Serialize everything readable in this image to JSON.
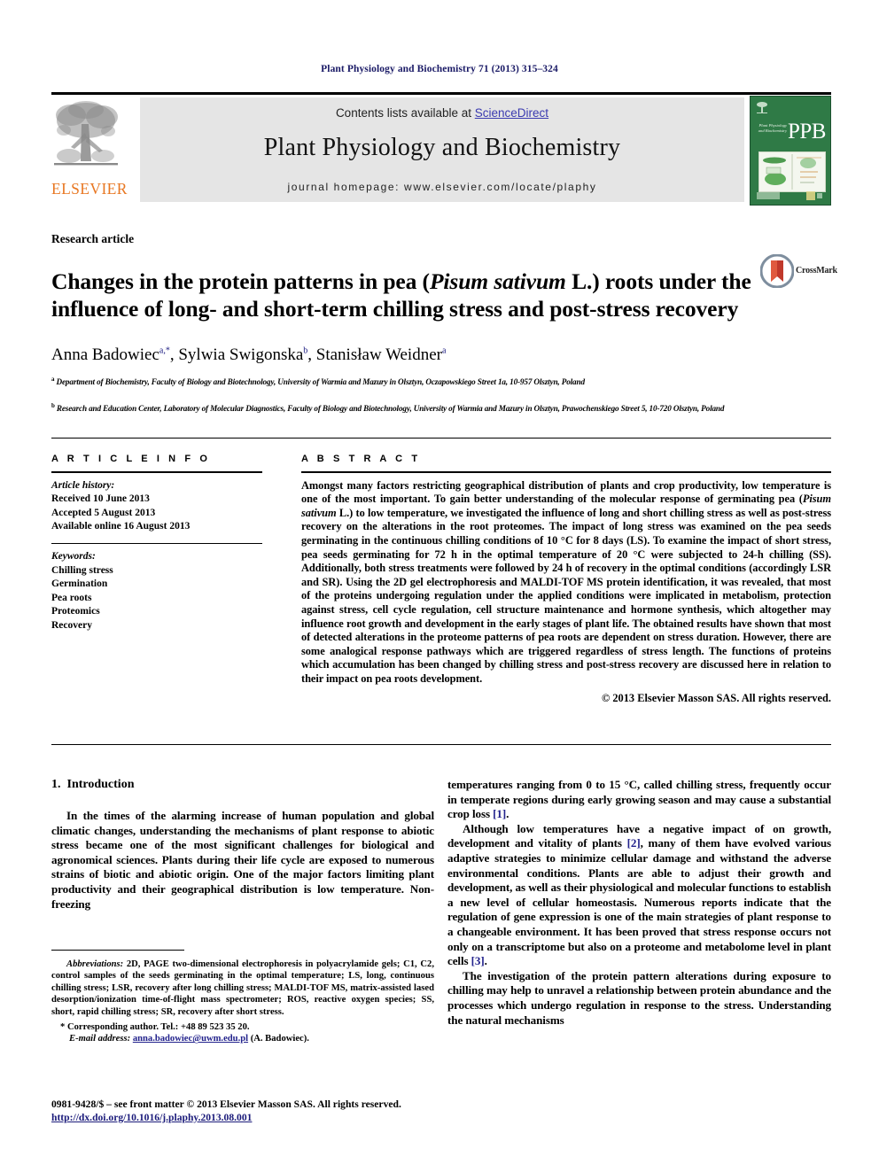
{
  "running_head": "Plant Physiology and Biochemistry 71 (2013) 315–324",
  "masthead": {
    "contents_prefix": "Contents lists available at ",
    "sciencedirect": "ScienceDirect",
    "journal_title": "Plant Physiology and Biochemistry",
    "homepage": "journal homepage: www.elsevier.com/locate/plaphy",
    "publisher_wordmark": "ELSEVIER",
    "cover_abbrev": "PPB",
    "cover_lines": "Plant Physiology and Biochemistry",
    "accent_orange": "#E87722",
    "cover_green": "#2f7a46",
    "link_blue": "#3a3ab0"
  },
  "article": {
    "type": "Research article",
    "title_part1": "Changes in the protein patterns in pea (",
    "title_italic": "Pisum sativum",
    "title_part2": " L.) roots under the influence of long- and short-term chilling stress and post-stress recovery",
    "crossmark_label": "CrossMark",
    "authors_html": "Anna Badowiec a,*, Sylwia Swigonska b, Stanisław Weidner a",
    "affiliation_a": "Department of Biochemistry, Faculty of Biology and Biotechnology, University of Warmia and Mazury in Olsztyn, Oczapowskiego Street 1a, 10-957 Olsztyn, Poland",
    "affiliation_b": "Research and Education Center, Laboratory of Molecular Diagnostics, Faculty of Biology and Biotechnology, University of Warmia and Mazury in Olsztyn, Prawochenskiego Street 5, 10-720 Olsztyn, Poland"
  },
  "info": {
    "heading": "A R T I C L E   I N F O",
    "history_label": "Article history:",
    "history": [
      "Received 10 June 2013",
      "Accepted 5 August 2013",
      "Available online 16 August 2013"
    ],
    "keywords_label": "Keywords:",
    "keywords": [
      "Chilling stress",
      "Germination",
      "Pea roots",
      "Proteomics",
      "Recovery"
    ]
  },
  "abstract": {
    "heading": "A B S T R A C T",
    "text_1": "Amongst many factors restricting geographical distribution of plants and crop productivity, low temperature is one of the most important. To gain better understanding of the molecular response of germinating pea (",
    "species": "Pisum sativum",
    "text_2": " L.) to low temperature, we investigated the influence of long and short chilling stress as well as post-stress recovery on the alterations in the root proteomes. The impact of long stress was examined on the pea seeds germinating in the continuous chilling conditions of 10 °C for 8 days (LS). To examine the impact of short stress, pea seeds germinating for 72 h in the optimal temperature of 20 °C were subjected to 24-h chilling (SS). Additionally, both stress treatments were followed by 24 h of recovery in the optimal conditions (accordingly LSR and SR). Using the 2D gel electrophoresis and MALDI-TOF MS protein identification, it was revealed, that most of the proteins undergoing regulation under the applied conditions were implicated in metabolism, protection against stress, cell cycle regulation, cell structure maintenance and hormone synthesis, which altogether may influence root growth and development in the early stages of plant life. The obtained results have shown that most of detected alterations in the proteome patterns of pea roots are dependent on stress duration. However, there are some analogical response pathways which are triggered regardless of stress length. The functions of proteins which accumulation has been changed by chilling stress and post-stress recovery are discussed here in relation to their impact on pea roots development.",
    "copyright": "© 2013 Elsevier Masson SAS. All rights reserved."
  },
  "introduction": {
    "number": "1.",
    "title": "Introduction",
    "left_p1": "In the times of the alarming increase of human population and global climatic changes, understanding the mechanisms of plant response to abiotic stress became one of the most significant challenges for biological and agronomical sciences. Plants during their life cycle are exposed to numerous strains of biotic and abiotic origin. One of the major factors limiting plant productivity and their geographical distribution is low temperature. Non-freezing",
    "right_p1_cont": "temperatures ranging from 0 to 15 °C, called chilling stress, frequently occur in temperate regions during early growing season and may cause a substantial crop loss ",
    "ref_1": "[1]",
    "right_p2_a": "Although low temperatures have a negative impact of on growth, development and vitality of plants ",
    "ref_2": "[2]",
    "right_p2_b": ", many of them have evolved various adaptive strategies to minimize cellular damage and withstand the adverse environmental conditions. Plants are able to adjust their growth and development, as well as their physiological and molecular functions to establish a new level of cellular homeostasis. Numerous reports indicate that the regulation of gene expression is one of the main strategies of plant response to a changeable environment. It has been proved that stress response occurs not only on a transcriptome but also on a proteome and metabolome level in plant cells ",
    "ref_3": "[3]",
    "right_p3": "The investigation of the protein pattern alterations during exposure to chilling may help to unravel a relationship between protein abundance and the processes which undergo regulation in response to the stress. Understanding the natural mechanisms"
  },
  "footnotes": {
    "abbrev_label": "Abbreviations:",
    "abbrev_text": " 2D, PAGE two-dimensional electrophoresis in polyacrylamide gels; C1, C2, control samples of the seeds germinating in the optimal temperature; LS, long, continuous chilling stress; LSR, recovery after long chilling stress; MALDI-TOF MS, matrix-assisted lased desorption/ionization time-of-flight mass spectrometer; ROS, reactive oxygen species; SS, short, rapid chilling stress; SR, recovery after short stress.",
    "corresponding": "* Corresponding author. Tel.: +48 89 523 35 20.",
    "email_label": "E-mail address:",
    "email": "anna.badowiec@uwm.edu.pl",
    "email_suffix": " (A. Badowiec)."
  },
  "footer": {
    "issn": "0981-9428/$ – see front matter © 2013 Elsevier Masson SAS. All rights reserved.",
    "doi": "http://dx.doi.org/10.1016/j.plaphy.2013.08.001"
  }
}
